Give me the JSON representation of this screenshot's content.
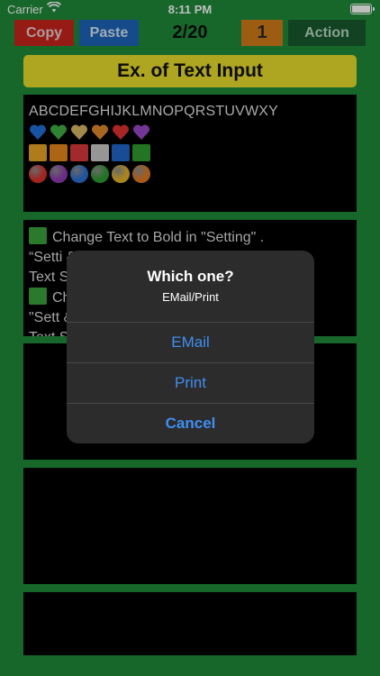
{
  "status_bar": {
    "carrier": "Carrier",
    "time": "8:11 PM"
  },
  "toolbar": {
    "copy_label": "Copy",
    "paste_label": "Paste",
    "counter": "2/20",
    "number_label": "1",
    "action_label": "Action"
  },
  "title": "Ex. of Text Input",
  "panel1": {
    "alphabet": "ABCDEFGHIJKLMNOPQRSTUVWXY",
    "hearts": [
      "#1f6fd6",
      "#3fae43",
      "#d8b766",
      "#e08a2c",
      "#e1322f",
      "#9b48c9"
    ],
    "squares": [
      "#e9a623",
      "#e6861d",
      "#d9383b",
      "#c9c9c9",
      "#2166c9",
      "#2f9d2f"
    ],
    "circles": [
      "#d9302a",
      "#8e3ab5",
      "#2a6fd4",
      "#2d9b30",
      "#e3b22a",
      "#e07a22"
    ]
  },
  "panel2": {
    "line1": "Change Text to Bold in \"Setting\" .",
    "line2": "“Setti                                                   &",
    "line3": "Text S",
    "line4": "Ch",
    "line5": " \"Sett                                                   &",
    "line6": "Text S                                                 ger"
  },
  "dialog": {
    "title": "Which one?",
    "message": "EMail/Print",
    "options": [
      "EMail",
      "Print"
    ],
    "cancel": "Cancel"
  },
  "colors": {
    "background": "#1f8a3a",
    "accent_blue": "#3f8ef0",
    "title_yellow": "#e8dc2c"
  }
}
